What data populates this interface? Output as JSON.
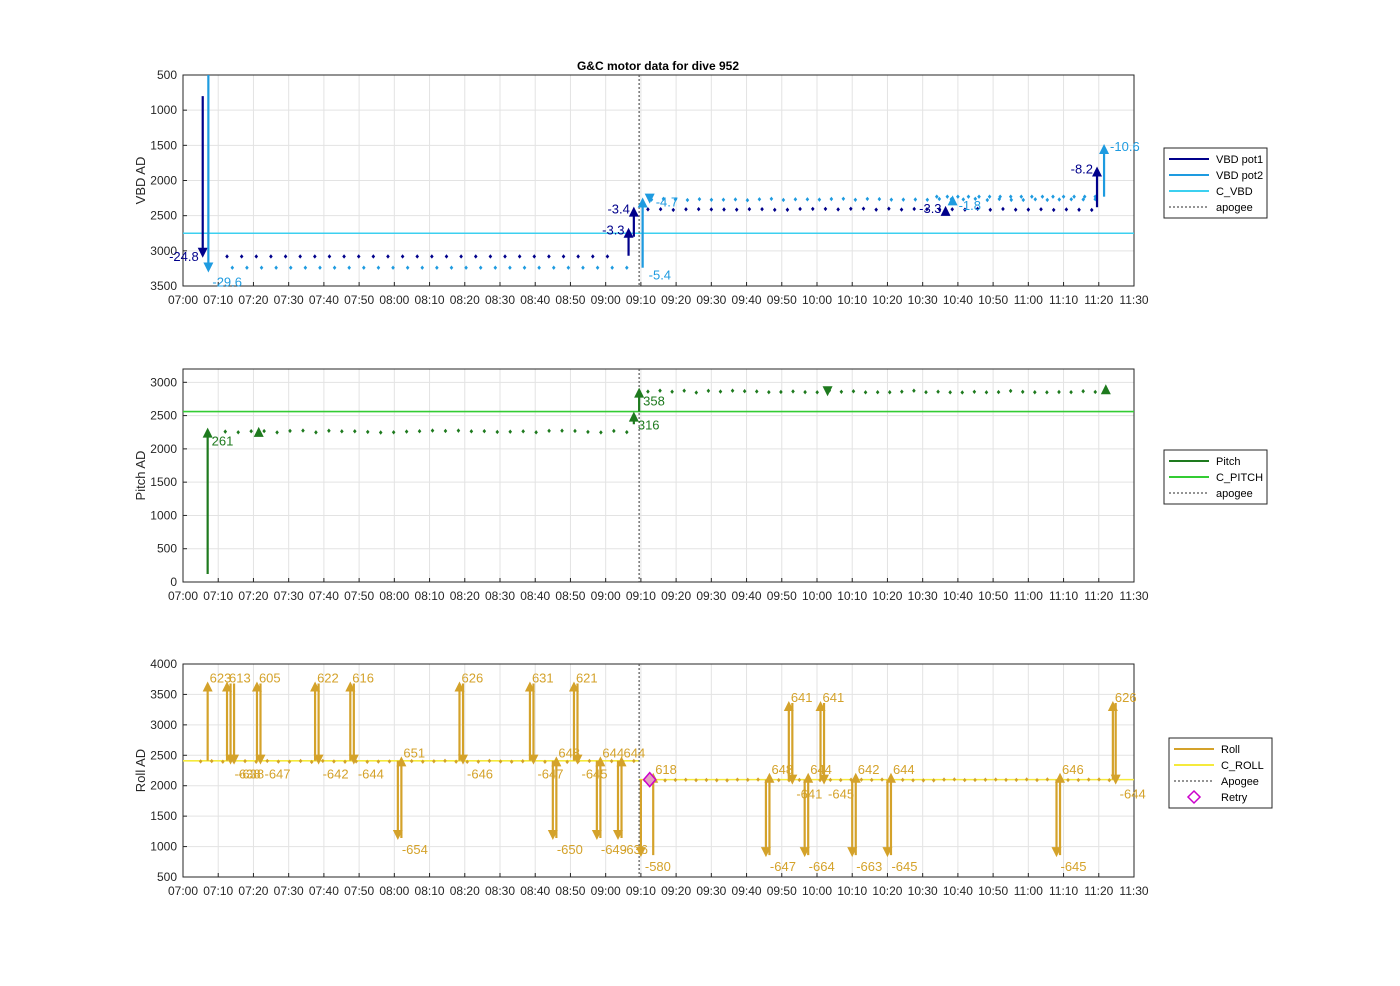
{
  "figure_title": "G&C motor data for dive 952",
  "chart_data": [
    {
      "type": "line",
      "title": "G&C motor data for dive 952",
      "ylabel": "VBD AD",
      "y_reversed": true,
      "ylim": [
        500,
        3500
      ],
      "yticks": [
        "500",
        "1000",
        "1500",
        "2000",
        "2500",
        "3000",
        "3500"
      ],
      "xlim_minutes": [
        420,
        690
      ],
      "xticks": [
        "07:00",
        "07:10",
        "07:20",
        "07:30",
        "07:40",
        "07:50",
        "08:00",
        "08:10",
        "08:20",
        "08:30",
        "08:40",
        "08:50",
        "09:00",
        "09:10",
        "09:20",
        "09:30",
        "09:40",
        "09:50",
        "10:00",
        "10:10",
        "10:20",
        "10:30",
        "10:40",
        "10:50",
        "11:00",
        "11:10",
        "11:20",
        "11:30"
      ],
      "grid": true,
      "legend_position": "right",
      "legend": [
        {
          "label": "VBD pot1",
          "color": "#00008b",
          "style": "solid"
        },
        {
          "label": "VBD pot2",
          "color": "#1e9be0",
          "style": "solid"
        },
        {
          "label": "C_VBD",
          "color": "#3cd0f0",
          "style": "solid"
        },
        {
          "label": "apogee",
          "color": "#555555",
          "style": "dotted"
        }
      ],
      "hlines": [
        {
          "y": 2750,
          "color": "#3cd0f0"
        }
      ],
      "apogee": 549.5,
      "series": [
        {
          "name": "VBD pot1",
          "color": "#00008b",
          "x_from": 432.5,
          "x_to": 540.5,
          "n": 27,
          "y": 3080,
          "jitter": 0
        },
        {
          "name": "VBD pot1",
          "color": "#00008b",
          "x_from": 552,
          "x_to": 678,
          "n": 36,
          "y": 2410,
          "jitter": 10
        },
        {
          "name": "VBD pot2",
          "color": "#1e9be0",
          "x_from": 434,
          "x_to": 546,
          "n": 28,
          "y": 3240,
          "jitter": 0
        },
        {
          "name": "VBD pot2",
          "color": "#1e9be0",
          "x_from": 553,
          "x_to": 679,
          "n": 38,
          "y": 2270,
          "jitter": 10
        },
        {
          "name": "VBD pot2",
          "color": "#1e9be0",
          "x_from": 634,
          "x_to": 679,
          "n": 16,
          "y": 2230,
          "jitter": 0
        }
      ],
      "arrows": [
        {
          "x": 425.6,
          "y_start": 800,
          "y_end": 3070,
          "color": "#00008b",
          "label": "-24.8",
          "label_side": "left"
        },
        {
          "x": 427.2,
          "y_start": 500,
          "y_end": 3280,
          "color": "#1e9be0",
          "label": "-29.6",
          "label_side": "below-right"
        },
        {
          "x": 546.5,
          "y_start": 3070,
          "y_end": 2700,
          "color": "#00008b",
          "label": "-3.3",
          "label_side": "left"
        },
        {
          "x": 548,
          "y_start": 2800,
          "y_end": 2400,
          "color": "#00008b",
          "label": "-3.4",
          "label_side": "left"
        },
        {
          "x": 550.5,
          "y_start": 3240,
          "y_end": 2270,
          "color": "#1e9be0",
          "label": "-5.4",
          "label_side": "right-low"
        },
        {
          "x": 552.5,
          "y_start": 2300,
          "y_end": 2300,
          "color": "#1e9be0",
          "label": "-4.7",
          "label_side": "right"
        },
        {
          "x": 636.5,
          "y_start": 2400,
          "y_end": 2390,
          "color": "#00008b",
          "label": "-3.3",
          "label_side": "left"
        },
        {
          "x": 638.5,
          "y_start": 2250,
          "y_end": 2240,
          "color": "#1e9be0",
          "label": "-1.8",
          "label_side": "right-low"
        },
        {
          "x": 679.5,
          "y_start": 2380,
          "y_end": 1830,
          "color": "#00008b",
          "label": "-8.2",
          "label_side": "left"
        },
        {
          "x": 681.5,
          "y_start": 2230,
          "y_end": 1510,
          "color": "#1e9be0",
          "label": "-10.6",
          "label_side": "right"
        }
      ]
    },
    {
      "type": "line",
      "title": "",
      "ylabel": "Pitch AD",
      "y_reversed": false,
      "ylim": [
        0,
        3200
      ],
      "yticks": [
        "0",
        "500",
        "1000",
        "1500",
        "2000",
        "2500",
        "3000"
      ],
      "xlim_minutes": [
        420,
        690
      ],
      "xticks": [
        "07:00",
        "07:10",
        "07:20",
        "07:30",
        "07:40",
        "07:50",
        "08:00",
        "08:10",
        "08:20",
        "08:30",
        "08:40",
        "08:50",
        "09:00",
        "09:10",
        "09:20",
        "09:30",
        "09:40",
        "09:50",
        "10:00",
        "10:10",
        "10:20",
        "10:30",
        "10:40",
        "10:50",
        "11:00",
        "11:10",
        "11:20",
        "11:30"
      ],
      "grid": true,
      "legend_position": "right",
      "legend": [
        {
          "label": "Pitch",
          "color": "#1e7a1e",
          "style": "solid"
        },
        {
          "label": "C_PITCH",
          "color": "#33cc33",
          "style": "solid"
        },
        {
          "label": "apogee",
          "color": "#555555",
          "style": "dotted"
        }
      ],
      "hlines": [
        {
          "y": 2560,
          "color": "#33cc33"
        }
      ],
      "apogee": 549.5,
      "series": [
        {
          "name": "Pitch",
          "color": "#1e7a1e",
          "x_from": 432,
          "x_to": 546,
          "n": 32,
          "y": 2260,
          "jitter": 15
        },
        {
          "name": "Pitch",
          "color": "#1e7a1e",
          "x_from": 552,
          "x_to": 679,
          "n": 38,
          "y": 2860,
          "jitter": 15
        }
      ],
      "arrows": [
        {
          "x": 427,
          "y_start": 120,
          "y_end": 2290,
          "color": "#1e7a1e",
          "label": "261",
          "label_side": "below-right"
        },
        {
          "x": 441.5,
          "y_start": 2290,
          "y_end": 2300,
          "color": "#1e7a1e",
          "label": "",
          "label_side": "none"
        },
        {
          "x": 548,
          "y_start": 2370,
          "y_end": 2530,
          "color": "#1e7a1e",
          "label": "316",
          "label_side": "below-right"
        },
        {
          "x": 549.5,
          "y_start": 2560,
          "y_end": 2890,
          "color": "#1e7a1e",
          "label": "358",
          "label_side": "below-right"
        },
        {
          "x": 603,
          "y_start": 2900,
          "y_end": 2820,
          "color": "#1e7a1e",
          "label": "",
          "label_side": "none"
        },
        {
          "x": 682,
          "y_start": 2880,
          "y_end": 2940,
          "color": "#1e7a1e",
          "label": "",
          "label_side": "none"
        }
      ]
    },
    {
      "type": "line",
      "title": "",
      "ylabel": "Roll AD",
      "y_reversed": false,
      "ylim": [
        500,
        4000
      ],
      "yticks": [
        "500",
        "1000",
        "1500",
        "2000",
        "2500",
        "3000",
        "3500",
        "4000"
      ],
      "xlim_minutes": [
        420,
        690
      ],
      "xticks": [
        "07:00",
        "07:10",
        "07:20",
        "07:30",
        "07:40",
        "07:50",
        "08:00",
        "08:10",
        "08:20",
        "08:30",
        "08:40",
        "08:50",
        "09:00",
        "09:10",
        "09:20",
        "09:30",
        "09:40",
        "09:50",
        "10:00",
        "10:10",
        "10:20",
        "10:30",
        "10:40",
        "10:50",
        "11:00",
        "11:10",
        "11:20",
        "11:30"
      ],
      "grid": true,
      "legend_position": "right",
      "legend": [
        {
          "label": "Roll",
          "color": "#d4a22a",
          "style": "solid"
        },
        {
          "label": "C_ROLL",
          "color": "#f5ea3c",
          "style": "solid"
        },
        {
          "label": "Apogee",
          "color": "#555555",
          "style": "dotted"
        },
        {
          "label": "Retry",
          "color": "#cc00cc",
          "style": "diamond"
        }
      ],
      "hlines": [
        {
          "y": 2410,
          "color": "#f5ea3c",
          "x_from": 420,
          "x_to": 549.5
        },
        {
          "y": 2100,
          "color": "#f5ea3c",
          "x_from": 549.5,
          "x_to": 690
        }
      ],
      "apogee": 549.5,
      "retry": {
        "x": 552.5,
        "y": 2100
      },
      "series": [
        {
          "name": "Roll",
          "color": "#d4a22a",
          "x_from": 425,
          "x_to": 548,
          "n": 40,
          "y": 2400,
          "jitter": 10
        },
        {
          "name": "Roll",
          "color": "#d4a22a",
          "x_from": 551,
          "x_to": 683,
          "n": 46,
          "y": 2095,
          "jitter": 8
        }
      ],
      "arrows": [
        {
          "x": 427,
          "y_start": 2410,
          "y_end": 3680,
          "color": "#d4a22a",
          "label": "623",
          "label_side": "top-right"
        },
        {
          "x": 432.5,
          "y_start": 2410,
          "y_end": 3680,
          "color": "#d4a22a",
          "label": "613",
          "label_side": "top-right"
        },
        {
          "x": 433.5,
          "y_start": 3680,
          "y_end": 2380,
          "color": "#d4a22a",
          "label": "-638",
          "label_side": "below-right"
        },
        {
          "x": 434.5,
          "y_start": 3680,
          "y_end": 2380,
          "color": "#d4a22a",
          "label": "-638",
          "label_side": "below-right"
        },
        {
          "x": 441,
          "y_start": 2410,
          "y_end": 3680,
          "color": "#d4a22a",
          "label": "605",
          "label_side": "top-right"
        },
        {
          "x": 442,
          "y_start": 3680,
          "y_end": 2380,
          "color": "#d4a22a",
          "label": "-647",
          "label_side": "below-right"
        },
        {
          "x": 457.5,
          "y_start": 2410,
          "y_end": 3680,
          "color": "#d4a22a",
          "label": "622",
          "label_side": "top-right"
        },
        {
          "x": 458.5,
          "y_start": 3680,
          "y_end": 2380,
          "color": "#d4a22a",
          "label": "-642",
          "label_side": "below-right"
        },
        {
          "x": 467.5,
          "y_start": 2410,
          "y_end": 3680,
          "color": "#d4a22a",
          "label": "616",
          "label_side": "top-right"
        },
        {
          "x": 468.5,
          "y_start": 3680,
          "y_end": 2380,
          "color": "#d4a22a",
          "label": "-644",
          "label_side": "below-right"
        },
        {
          "x": 481,
          "y_start": 2410,
          "y_end": 1140,
          "color": "#d4a22a",
          "label": "-654",
          "label_side": "below-right"
        },
        {
          "x": 482,
          "y_start": 1140,
          "y_end": 2450,
          "color": "#d4a22a",
          "label": "651",
          "label_side": "top-right"
        },
        {
          "x": 498.5,
          "y_start": 2410,
          "y_end": 3680,
          "color": "#d4a22a",
          "label": "626",
          "label_side": "top-right"
        },
        {
          "x": 499.5,
          "y_start": 3680,
          "y_end": 2380,
          "color": "#d4a22a",
          "label": "-646",
          "label_side": "below-right"
        },
        {
          "x": 518.5,
          "y_start": 2410,
          "y_end": 3680,
          "color": "#d4a22a",
          "label": "631",
          "label_side": "top-right"
        },
        {
          "x": 519.5,
          "y_start": 3680,
          "y_end": 2380,
          "color": "#d4a22a",
          "label": "-647",
          "label_side": "below-right"
        },
        {
          "x": 525,
          "y_start": 2410,
          "y_end": 1140,
          "color": "#d4a22a",
          "label": "-650",
          "label_side": "below-right"
        },
        {
          "x": 526,
          "y_start": 1140,
          "y_end": 2450,
          "color": "#d4a22a",
          "label": "648",
          "label_side": "top-right"
        },
        {
          "x": 531,
          "y_start": 2410,
          "y_end": 3680,
          "color": "#d4a22a",
          "label": "621",
          "label_side": "top-right"
        },
        {
          "x": 532,
          "y_start": 3680,
          "y_end": 2380,
          "color": "#d4a22a",
          "label": "-645",
          "label_side": "below-right"
        },
        {
          "x": 537.5,
          "y_start": 2410,
          "y_end": 1140,
          "color": "#d4a22a",
          "label": "-649",
          "label_side": "below-right"
        },
        {
          "x": 538.5,
          "y_start": 1140,
          "y_end": 2450,
          "color": "#d4a22a",
          "label": "644",
          "label_side": "top-right"
        },
        {
          "x": 543.5,
          "y_start": 2410,
          "y_end": 1140,
          "color": "#d4a22a",
          "label": "-636",
          "label_side": "below-right"
        },
        {
          "x": 544.5,
          "y_start": 1140,
          "y_end": 2450,
          "color": "#d4a22a",
          "label": "644",
          "label_side": "top-right"
        },
        {
          "x": 550,
          "y_start": 2100,
          "y_end": 860,
          "color": "#d4a22a",
          "label": "-580",
          "label_side": "below-right"
        },
        {
          "x": 553.5,
          "y_start": 860,
          "y_end": 2180,
          "color": "#d4a22a",
          "label": "618",
          "label_side": "top-right"
        },
        {
          "x": 585.5,
          "y_start": 2100,
          "y_end": 860,
          "color": "#d4a22a",
          "label": "-647",
          "label_side": "below-right"
        },
        {
          "x": 586.5,
          "y_start": 860,
          "y_end": 2180,
          "color": "#d4a22a",
          "label": "648",
          "label_side": "top-right"
        },
        {
          "x": 592,
          "y_start": 2100,
          "y_end": 3360,
          "color": "#d4a22a",
          "label": "641",
          "label_side": "top-right"
        },
        {
          "x": 593,
          "y_start": 3360,
          "y_end": 2050,
          "color": "#d4a22a",
          "label": "-641",
          "label_side": "below-right"
        },
        {
          "x": 596.5,
          "y_start": 2100,
          "y_end": 860,
          "color": "#d4a22a",
          "label": "-664",
          "label_side": "below-right"
        },
        {
          "x": 597.5,
          "y_start": 860,
          "y_end": 2180,
          "color": "#d4a22a",
          "label": "644",
          "label_side": "top-right"
        },
        {
          "x": 601,
          "y_start": 2100,
          "y_end": 3360,
          "color": "#d4a22a",
          "label": "641",
          "label_side": "top-right"
        },
        {
          "x": 602,
          "y_start": 3360,
          "y_end": 2050,
          "color": "#d4a22a",
          "label": "-645",
          "label_side": "below-right"
        },
        {
          "x": 610,
          "y_start": 2100,
          "y_end": 860,
          "color": "#d4a22a",
          "label": "-663",
          "label_side": "below-right"
        },
        {
          "x": 611,
          "y_start": 860,
          "y_end": 2180,
          "color": "#d4a22a",
          "label": "642",
          "label_side": "top-right"
        },
        {
          "x": 620,
          "y_start": 2100,
          "y_end": 860,
          "color": "#d4a22a",
          "label": "-645",
          "label_side": "below-right"
        },
        {
          "x": 621,
          "y_start": 860,
          "y_end": 2180,
          "color": "#d4a22a",
          "label": "644",
          "label_side": "top-right"
        },
        {
          "x": 668,
          "y_start": 2100,
          "y_end": 860,
          "color": "#d4a22a",
          "label": "-645",
          "label_side": "below-right"
        },
        {
          "x": 669,
          "y_start": 860,
          "y_end": 2180,
          "color": "#d4a22a",
          "label": "646",
          "label_side": "top-right"
        },
        {
          "x": 684,
          "y_start": 2100,
          "y_end": 3360,
          "color": "#d4a22a",
          "label": "626",
          "label_side": "top-right"
        },
        {
          "x": 684.8,
          "y_start": 3360,
          "y_end": 2050,
          "color": "#d4a22a",
          "label": "-644",
          "label_side": "below-right"
        }
      ]
    }
  ]
}
